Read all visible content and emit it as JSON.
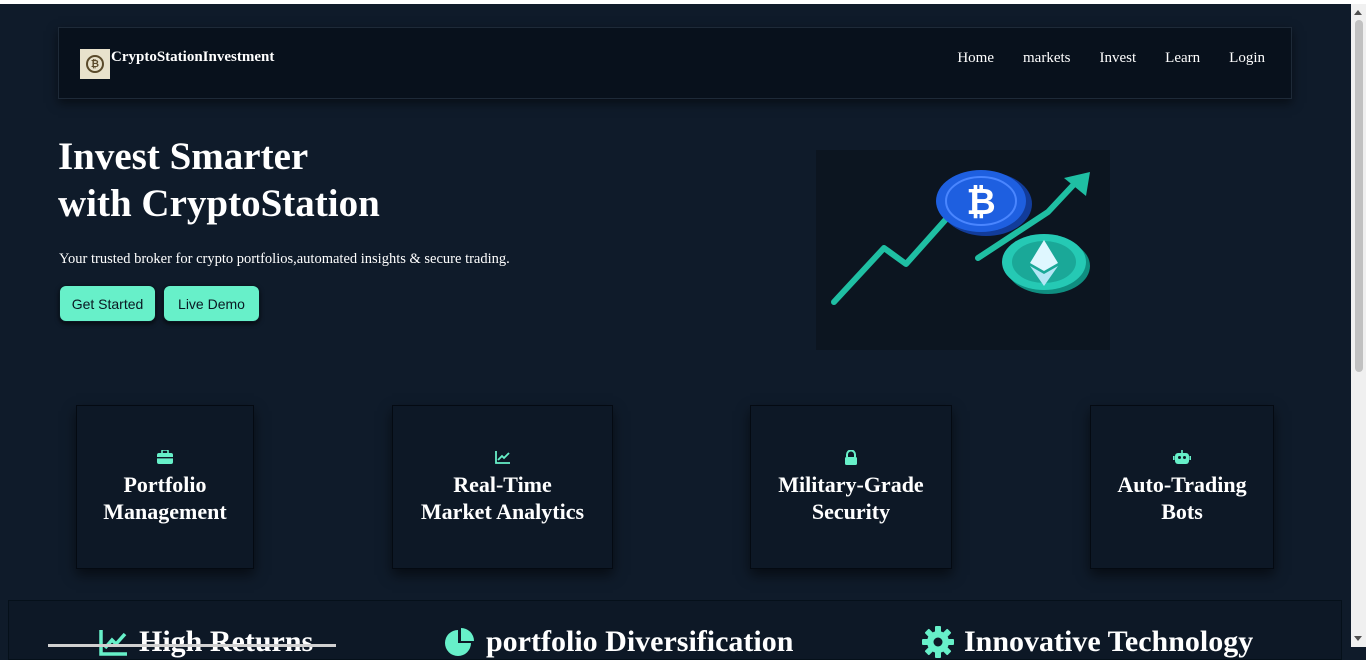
{
  "brand": {
    "name": "CryptoStationInvestment",
    "logo_icon": "bitcoin-logo"
  },
  "nav": {
    "items": [
      "Home",
      "markets",
      "Invest",
      "Learn",
      "Login"
    ]
  },
  "hero": {
    "title_line1": "Invest Smarter",
    "title_line2": "with CryptoStation",
    "subtitle": "Your trusted broker for crypto portfolios,automated insights & secure trading.",
    "buttons": {
      "primary": "Get Started",
      "secondary": "Live Demo"
    }
  },
  "cards": [
    {
      "icon": "briefcase-icon",
      "line1": "Portfolio",
      "line2": "Management"
    },
    {
      "icon": "chart-line-icon",
      "line1": "Real-Time",
      "line2": "Market Analytics"
    },
    {
      "icon": "lock-icon",
      "line1": "Military-Grade",
      "line2": "Security"
    },
    {
      "icon": "robot-icon",
      "line1": "Auto-Trading",
      "line2": "Bots"
    }
  ],
  "features": [
    {
      "icon": "chart-line-icon",
      "label": "High Returns"
    },
    {
      "icon": "pie-chart-icon",
      "label": "portfolio Diversification"
    },
    {
      "icon": "gear-icon",
      "label": "Innovative Technology"
    }
  ],
  "colors": {
    "background": "#0f1b2a",
    "accent": "#67f0c9",
    "navbar": "#08111c",
    "bitcoin": "#1e5fe0",
    "ethereum": "#25c9b4"
  }
}
